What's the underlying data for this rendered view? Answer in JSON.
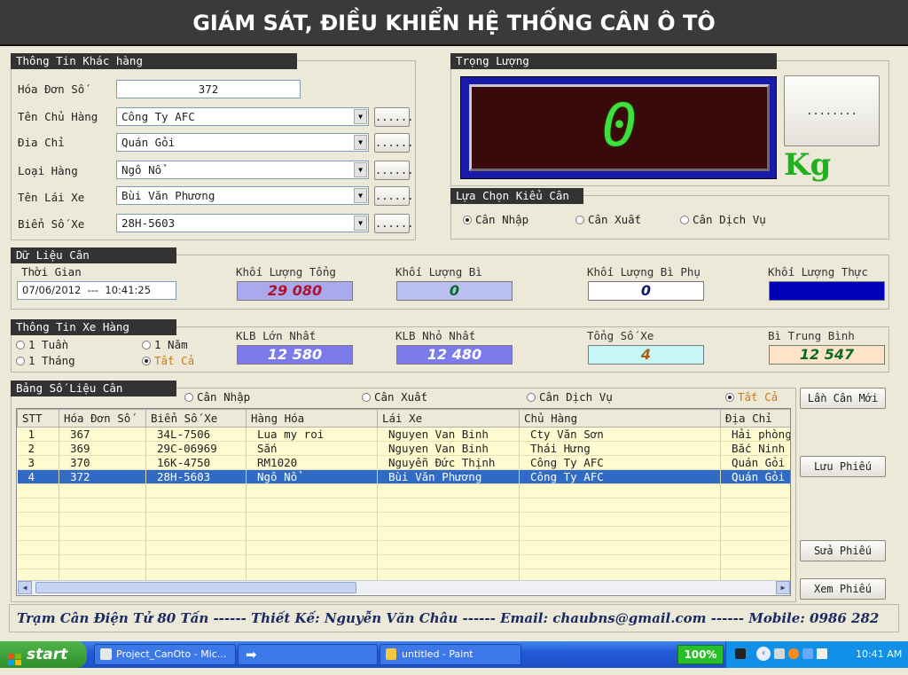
{
  "title": "GIÁM SÁT, ĐIỀU KHIỂN HỆ THỐNG CÂN Ô TÔ",
  "customer": {
    "header": "Thông Tin Khác hàng",
    "invoice_label": "Hóa Đơn Số",
    "invoice_value": "372",
    "owner_label": "Tên Chủ Hàng",
    "owner_value": "Công Ty AFC",
    "address_label": "Đia Chỉ",
    "address_value": "Quán Gỏi",
    "goods_label": "Loại Hàng",
    "goods_value": "Ngô Nổ",
    "driver_label": "Tên Lái Xe",
    "driver_value": "Bùi Văn Phương",
    "plate_label": "Biển Số Xe",
    "plate_value": "28H-5603",
    "more_button": "......"
  },
  "weight": {
    "header": "Trọng Lượng",
    "display_value": "0",
    "side_button": "........",
    "unit": "Kg"
  },
  "mode": {
    "header": "Lựa Chọn Kiểu Cân",
    "options": [
      "Cân Nhập",
      "Cân Xuất",
      "Cân Dịch Vụ"
    ],
    "selected": "Cân Nhập"
  },
  "weigh_data": {
    "header": "Dữ Liệu Cân",
    "time_label": "Thời Gian",
    "date": "07/06/2012",
    "sep": "---",
    "time": "10:41:25",
    "total_label": "Khối Lượng Tổng",
    "total_value": "29 080",
    "tare_label": "Khối Lượng Bì",
    "tare_value": "0",
    "tare_extra_label": "Khối Lượng Bì Phụ",
    "tare_extra_value": "0",
    "net_label": "Khối Lượng Thực",
    "net_value": ""
  },
  "vehicle": {
    "header": "Thông Tin Xe Hàng",
    "period_options": [
      "1 Tuần",
      "1 Năm",
      "1 Tháng",
      "Tất Cả"
    ],
    "selected": "Tất Cả",
    "max_label": "KLB Lớn Nhất",
    "max_value": "12 580",
    "min_label": "KLB Nhỏ Nhất",
    "min_value": "12 480",
    "count_label": "Tổng Số Xe",
    "count_value": "4",
    "avg_label": "Bì Trung Bình",
    "avg_value": "12 547"
  },
  "table": {
    "header": "Bảng Số Liệu Cân",
    "filters": [
      "Cân Nhập",
      "Cân Xuất",
      "Cân Dịch Vụ",
      "Tất Cả"
    ],
    "selected_filter": "Tất Cả",
    "columns": [
      "STT",
      "Hóa Đơn Số",
      "Biển Số Xe",
      "Hàng Hóa",
      "Lái Xe",
      "Chủ Hàng",
      "Địa Chỉ"
    ],
    "rows": [
      [
        "1",
        "367",
        "34L-7506",
        "Lua my roi",
        "Nguyen Van Binh",
        "Cty Văn Sơn",
        "Hải phòng"
      ],
      [
        "2",
        "369",
        "29C-06969",
        "Sắn",
        "Nguyen Van Binh",
        "Thái Hưng",
        "Bắc Ninh"
      ],
      [
        "3",
        "370",
        "16K-4750",
        "RM1020",
        "Nguyễn Đức Thịnh",
        "Công Ty AFC",
        "Quán Gỏi"
      ],
      [
        "4",
        "372",
        "28H-5603",
        "Ngô Nổ",
        "Bùi Văn Phương",
        "Công Ty AFC",
        "Quán Gỏi"
      ]
    ],
    "selected_row": 3
  },
  "actions": {
    "new": "Lần Cân Mới",
    "save": "Lưu Phiếu",
    "edit": "Sửa Phiếu",
    "view": "Xem Phiếu"
  },
  "footer": "Trạm Cân Điện Tử 80 Tấn ------ Thiết Kế: Nguyễn Văn Châu ------ Email: chaubns@gmail.com ------ Mobile: 0986 282",
  "taskbar": {
    "start": "start",
    "items": [
      "Project_CanOto - Mic...",
      "",
      "untitled - Paint"
    ],
    "zoom": "100%",
    "clock": "10:41 AM"
  },
  "colors": {
    "title_bg": "#3a3a3a",
    "lcd_digit": "#3ee03e",
    "lcd_bg": "#3a0a0a",
    "kg_text": "#20b020",
    "total_bg": "#a9a9ee",
    "tare_bg": "#b9bfee",
    "net_bg": "#0000b8",
    "selected_row": "#316ac5"
  }
}
